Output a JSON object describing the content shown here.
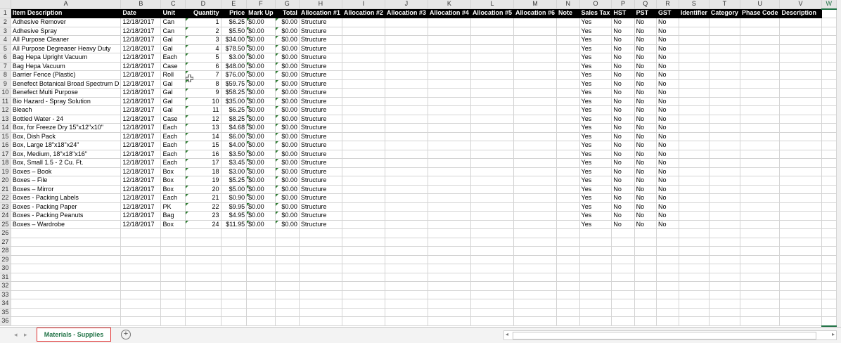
{
  "columns": [
    "A",
    "B",
    "C",
    "D",
    "E",
    "F",
    "G",
    "H",
    "I",
    "J",
    "K",
    "L",
    "M",
    "N",
    "O",
    "P",
    "Q",
    "R",
    "S",
    "T",
    "U",
    "V",
    "W"
  ],
  "col_widths": [
    144,
    63,
    42,
    58,
    40,
    40,
    40,
    56,
    60,
    61,
    57,
    57,
    56,
    39,
    40,
    40,
    39,
    39,
    40,
    40,
    50,
    63,
    28
  ],
  "header_row": [
    "Item Description",
    "Date",
    "Unit",
    "Quantity",
    "Price",
    "Mark Up",
    "Total",
    "Allocation #1",
    "Allocation #2",
    "Allocation #3",
    "Allocation #4",
    "Allocation #5",
    "Allocation #6",
    "Note",
    "Sales Tax",
    "HST",
    "PST",
    "GST",
    "Identifier",
    "Category",
    "Phase Code",
    "Description",
    ""
  ],
  "rows": [
    [
      "Adhesive Remover",
      "12/18/2017",
      "Can",
      "1",
      "$6.25",
      "$0.00",
      "$0.00",
      "Structure",
      "Yes",
      "No",
      "No",
      "No"
    ],
    [
      "Adhesive Spray",
      "12/18/2017",
      "Can",
      "2",
      "$5.50",
      "$0.00",
      "$0.00",
      "Structure",
      "Yes",
      "No",
      "No",
      "No"
    ],
    [
      "All Purpose Cleaner",
      "12/18/2017",
      "Gal",
      "3",
      "$34.00",
      "$0.00",
      "$0.00",
      "Structure",
      "Yes",
      "No",
      "No",
      "No"
    ],
    [
      "All Purpose Degreaser Heavy Duty",
      "12/18/2017",
      "Gal",
      "4",
      "$78.50",
      "$0.00",
      "$0.00",
      "Structure",
      "Yes",
      "No",
      "No",
      "No"
    ],
    [
      "Bag Hepa Upright Vacuum",
      "12/18/2017",
      "Each",
      "5",
      "$3.00",
      "$0.00",
      "$0.00",
      "Structure",
      "Yes",
      "No",
      "No",
      "No"
    ],
    [
      "Bag Hepa Vacuum",
      "12/18/2017",
      "Case",
      "6",
      "$48.00",
      "$0.00",
      "$0.00",
      "Structure",
      "Yes",
      "No",
      "No",
      "No"
    ],
    [
      "Barrier Fence (Plastic)",
      "12/18/2017",
      "Roll",
      "7",
      "$76.00",
      "$0.00",
      "$0.00",
      "Structure",
      "Yes",
      "No",
      "No",
      "No"
    ],
    [
      "Benefect Botanical Broad Spectrum D",
      "12/18/2017",
      "Gal",
      "8",
      "$59.75",
      "$0.00",
      "$0.00",
      "Structure",
      "Yes",
      "No",
      "No",
      "No"
    ],
    [
      "Benefect Multi Purpose",
      "12/18/2017",
      "Gal",
      "9",
      "$58.25",
      "$0.00",
      "$0.00",
      "Structure",
      "Yes",
      "No",
      "No",
      "No"
    ],
    [
      "Bio Hazard -  Spray Solution",
      "12/18/2017",
      "Gal",
      "10",
      "$35.00",
      "$0.00",
      "$0.00",
      "Structure",
      "Yes",
      "No",
      "No",
      "No"
    ],
    [
      "Bleach",
      "12/18/2017",
      "Gal",
      "11",
      "$6.25",
      "$0.00",
      "$0.00",
      "Structure",
      "Yes",
      "No",
      "No",
      "No"
    ],
    [
      "Bottled Water - 24",
      "12/18/2017",
      "Case",
      "12",
      "$8.25",
      "$0.00",
      "$0.00",
      "Structure",
      "Yes",
      "No",
      "No",
      "No"
    ],
    [
      "Box, for Freeze Dry 15\"x12\"x10\"",
      "12/18/2017",
      "Each",
      "13",
      "$4.68",
      "$0.00",
      "$0.00",
      "Structure",
      "Yes",
      "No",
      "No",
      "No"
    ],
    [
      "Box, Dish Pack",
      "12/18/2017",
      "Each",
      "14",
      "$6.00",
      "$0.00",
      "$0.00",
      "Structure",
      "Yes",
      "No",
      "No",
      "No"
    ],
    [
      "Box, Large 18\"x18\"x24\"",
      "12/18/2017",
      "Each",
      "15",
      "$4.00",
      "$0.00",
      "$0.00",
      "Structure",
      "Yes",
      "No",
      "No",
      "No"
    ],
    [
      "Box, Medium, 18\"x18\"x16\"",
      "12/18/2017",
      "Each",
      "16",
      "$3.50",
      "$0.00",
      "$0.00",
      "Structure",
      "Yes",
      "No",
      "No",
      "No"
    ],
    [
      "Box, Small 1.5 - 2 Cu. Ft.",
      "12/18/2017",
      "Each",
      "17",
      "$3.45",
      "$0.00",
      "$0.00",
      "Structure",
      "Yes",
      "No",
      "No",
      "No"
    ],
    [
      "Boxes – Book",
      "12/18/2017",
      "Box",
      "18",
      "$3.00",
      "$0.00",
      "$0.00",
      "Structure",
      "Yes",
      "No",
      "No",
      "No"
    ],
    [
      "Boxes – File",
      "12/18/2017",
      "Box",
      "19",
      "$5.25",
      "$0.00",
      "$0.00",
      "Structure",
      "Yes",
      "No",
      "No",
      "No"
    ],
    [
      "Boxes – Mirror",
      "12/18/2017",
      "Box",
      "20",
      "$5.00",
      "$0.00",
      "$0.00",
      "Structure",
      "Yes",
      "No",
      "No",
      "No"
    ],
    [
      "Boxes - Packing Labels",
      "12/18/2017",
      "Each",
      "21",
      "$0.90",
      "$0.00",
      "$0.00",
      "Structure",
      "Yes",
      "No",
      "No",
      "No"
    ],
    [
      "Boxes - Packing Paper",
      "12/18/2017",
      "PK",
      "22",
      "$9.95",
      "$0.00",
      "$0.00",
      "Structure",
      "Yes",
      "No",
      "No",
      "No"
    ],
    [
      "Boxes - Packing Peanuts",
      "12/18/2017",
      "Bag",
      "23",
      "$4.95",
      "$0.00",
      "$0.00",
      "Structure",
      "Yes",
      "No",
      "No",
      "No"
    ],
    [
      "Boxes – Wardrobe",
      "12/18/2017",
      "Box",
      "24",
      "$11.95",
      "$0.00",
      "$0.00",
      "Structure",
      "Yes",
      "No",
      "No",
      "No"
    ]
  ],
  "total_rows": 36,
  "sheet_tab": "Materials - Supplies",
  "add_sheet_symbol": "+",
  "accent_color": "#217346",
  "tab_highlight_color": "#e03030"
}
